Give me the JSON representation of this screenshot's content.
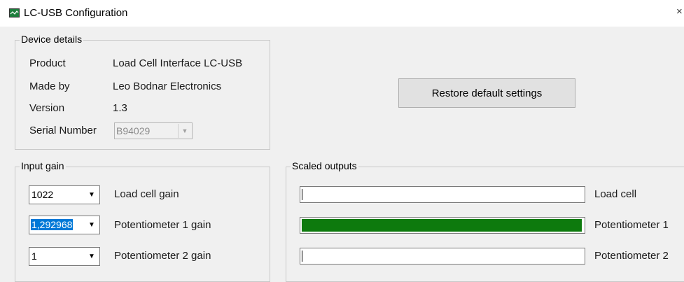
{
  "window": {
    "title": "LC-USB Configuration",
    "close_glyph": "×",
    "icon": "app-icon"
  },
  "device_details": {
    "label": "Device details",
    "rows": [
      {
        "key": "Product",
        "value": "Load Cell Interface LC-USB"
      },
      {
        "key": "Made by",
        "value": "Leo Bodnar Electronics"
      },
      {
        "key": "Version",
        "value": "1.3"
      }
    ],
    "serial_label": "Serial Number",
    "serial_value": "B94029"
  },
  "restore_button": "Restore default settings",
  "input_gain": {
    "label": "Input gain",
    "rows": [
      {
        "value": "1022",
        "label": "Load cell gain"
      },
      {
        "value": "1,292968",
        "label": "Potentiometer 1 gain"
      },
      {
        "value": "1",
        "label": "Potentiometer 2 gain"
      }
    ]
  },
  "scaled_outputs": {
    "label": "Scaled outputs",
    "rows": [
      {
        "label": "Load cell",
        "fill": 0.0
      },
      {
        "label": "Potentiometer 1",
        "fill": 1.0
      },
      {
        "label": "Potentiometer 2",
        "fill": 0.0
      }
    ],
    "fill_color": "#0d7a0d"
  }
}
